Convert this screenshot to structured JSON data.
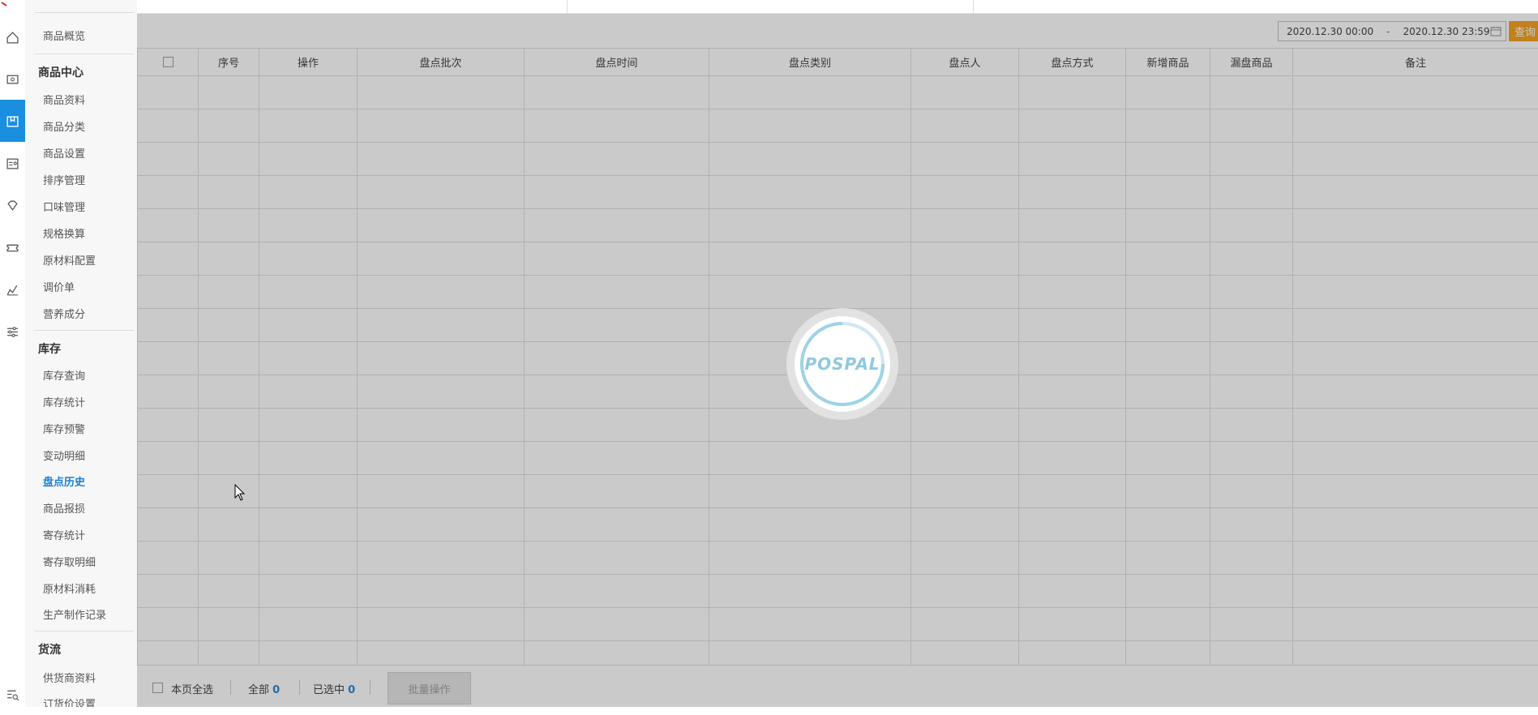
{
  "sidebar": {
    "groups": [
      {
        "label": "商品中心"
      },
      {
        "label": "库存"
      },
      {
        "label": "货流"
      }
    ],
    "overview": "商品概览",
    "goods_items": [
      "商品资料",
      "商品分类",
      "商品设置",
      "排序管理",
      "口味管理",
      "规格换算",
      "原材料配置",
      "调价单",
      "营养成分"
    ],
    "stock_items": [
      "库存查询",
      "库存统计",
      "库存预警",
      "变动明细",
      "盘点历史",
      "商品报损",
      "寄存统计",
      "寄存取明细",
      "原材料消耗",
      "生产制作记录"
    ],
    "flow_items": [
      "供货商资料",
      "订货价设置"
    ],
    "active_item": "盘点历史"
  },
  "filter": {
    "date_from": "2020.12.30 00:00",
    "date_sep": "-",
    "date_to": "2020.12.30 23:59",
    "query_label": "查询"
  },
  "table": {
    "columns": [
      "序号",
      "操作",
      "盘点批次",
      "盘点时间",
      "盘点类别",
      "盘点人",
      "盘点方式",
      "新增商品",
      "漏盘商品",
      "备注"
    ],
    "rows": []
  },
  "footer": {
    "select_page_label": "本页全选",
    "total_label": "全部",
    "total_count": "0",
    "selected_label": "已选中",
    "selected_count": "0",
    "batch_label": "批量操作"
  },
  "loader": {
    "brand": "POSPAL"
  },
  "colors": {
    "accent": "#1a8fe0",
    "query_button": "#f39c12",
    "active_link": "#1a7fd4"
  }
}
